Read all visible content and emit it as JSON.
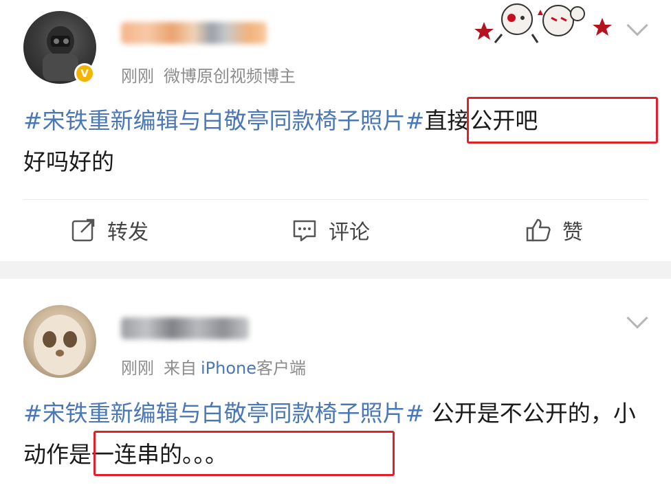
{
  "posts": [
    {
      "time": "刚刚",
      "source": "微博原创视频博主",
      "hashtag": "#宋铁重新编辑与白敬亭同款椅子照片#",
      "text_highlight": "直接公开吧",
      "text_rest": "好吗好的"
    },
    {
      "time": "刚刚",
      "source_prefix": "来自",
      "source_device": "iPhone",
      "source_suffix": "客户端",
      "hashtag": "#宋铁重新编辑与白敬亭同款椅子照片#",
      "text_plain": " 公开是不公开的，",
      "text_highlight": "小动作是一连串的。。。"
    }
  ],
  "actions": {
    "repost": "转发",
    "comment": "评论",
    "like": "赞"
  },
  "colors": {
    "hashtag": "#4a77b5",
    "highlight_border": "#e0202a",
    "verified_badge": "#f5b400"
  },
  "icons": [
    "verified-badge-icon",
    "chevron-down-icon",
    "repost-icon",
    "comment-icon",
    "like-icon"
  ]
}
